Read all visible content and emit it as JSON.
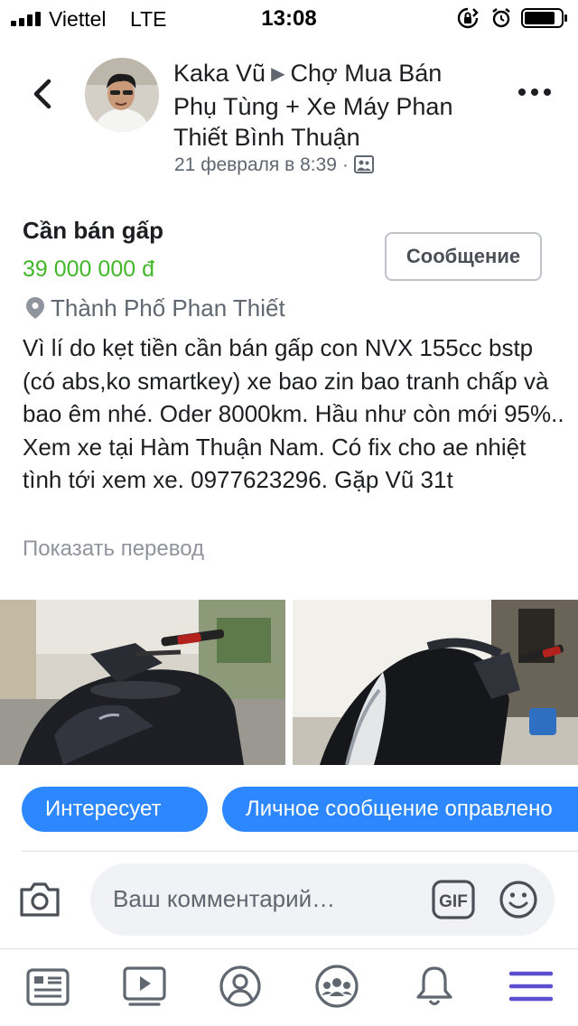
{
  "status_bar": {
    "carrier": "Viettel",
    "network": "LTE",
    "time": "13:08"
  },
  "header": {
    "author": "Kaka Vũ",
    "group": "Chợ Mua Bán Phụ Tùng + Xe Máy Phan Thiết Bình Thuận",
    "date": "21 февраля в 8:39",
    "separator": "·"
  },
  "listing": {
    "title": "Cần bán gấp",
    "price": "39 000 000 đ",
    "location": "Thành Phố Phan Thiết",
    "message_button": "Сообщение",
    "description": "Vì lí do kẹt tiền cần bán gấp con NVX 155cc bstp (có abs,ko smartkey) xe bao zin bao tranh chấp và bao êm nhé. Oder 8000km. Hầu như còn mới 95%.. Xem xe tại Hàm Thuận Nam. Có fix cho ae nhiệt tình tới xem xe. 0977623296. Gặp Vũ 31t",
    "translate_link": "Показать перевод"
  },
  "actions": {
    "interested": "Интересует",
    "private_message": "Личное сообщение оправлено"
  },
  "comment_bar": {
    "placeholder": "Ваш комментарий…",
    "gif_label": "GIF"
  },
  "colors": {
    "price_green": "#42b72a",
    "accent_blue": "#2d88ff",
    "active_tab": "#5a4fcf"
  },
  "tabs": [
    "news-feed",
    "watch",
    "profile",
    "groups",
    "notifications",
    "menu"
  ]
}
